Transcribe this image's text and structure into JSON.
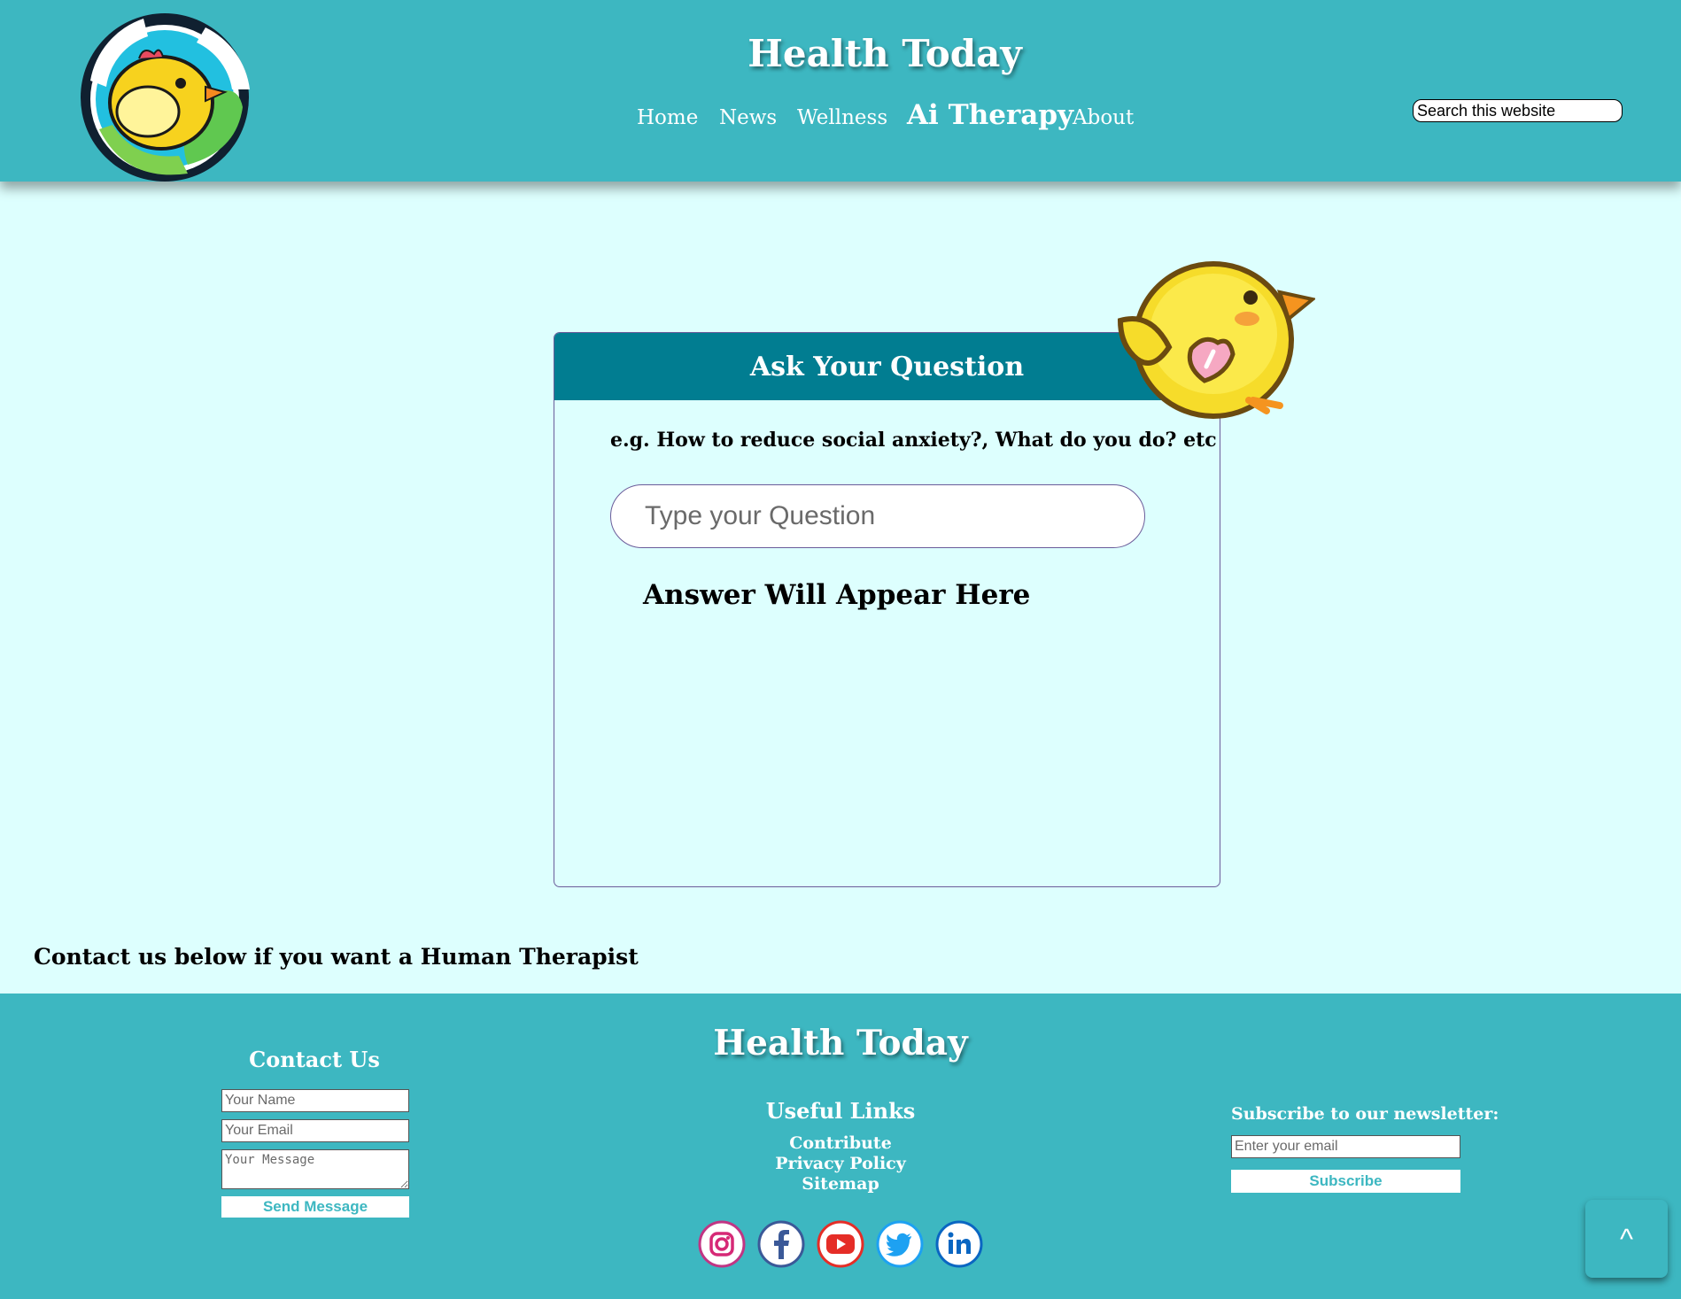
{
  "header": {
    "title": "Health Today",
    "search_placeholder": "Search this website",
    "nav": [
      {
        "label": "Home"
      },
      {
        "label": "News"
      },
      {
        "label": "Wellness"
      },
      {
        "label": "Ai Therapy",
        "active": true
      },
      {
        "label": "About"
      }
    ]
  },
  "chat": {
    "heading": "Ask Your Question",
    "example": "e.g. How to reduce social anxiety?, What do you do? etc",
    "input_placeholder": "Type your Question",
    "answer_placeholder": "Answer Will Appear Here"
  },
  "human_note": "Contact us below if you want a Human Therapist",
  "footer": {
    "title": "Health Today",
    "contact": {
      "heading": "Contact Us",
      "name_placeholder": "Your Name",
      "email_placeholder": "Your Email",
      "message_placeholder": "Your Message",
      "send_label": "Send Message"
    },
    "links": {
      "heading": "Useful Links",
      "items": [
        "Contribute",
        "Privacy Policy",
        "Sitemap"
      ]
    },
    "newsletter": {
      "heading": "Subscribe to our newsletter:",
      "email_placeholder": "Enter your email",
      "subscribe_label": "Subscribe"
    },
    "social": [
      "instagram-icon",
      "facebook-icon",
      "youtube-icon",
      "twitter-icon",
      "linkedin-icon"
    ]
  },
  "back_to_top_label": "^",
  "colors": {
    "header_bg": "#3db7c1",
    "page_bg": "#ddfffe",
    "card_header": "#017d91",
    "card_border": "#6b5c9a"
  }
}
